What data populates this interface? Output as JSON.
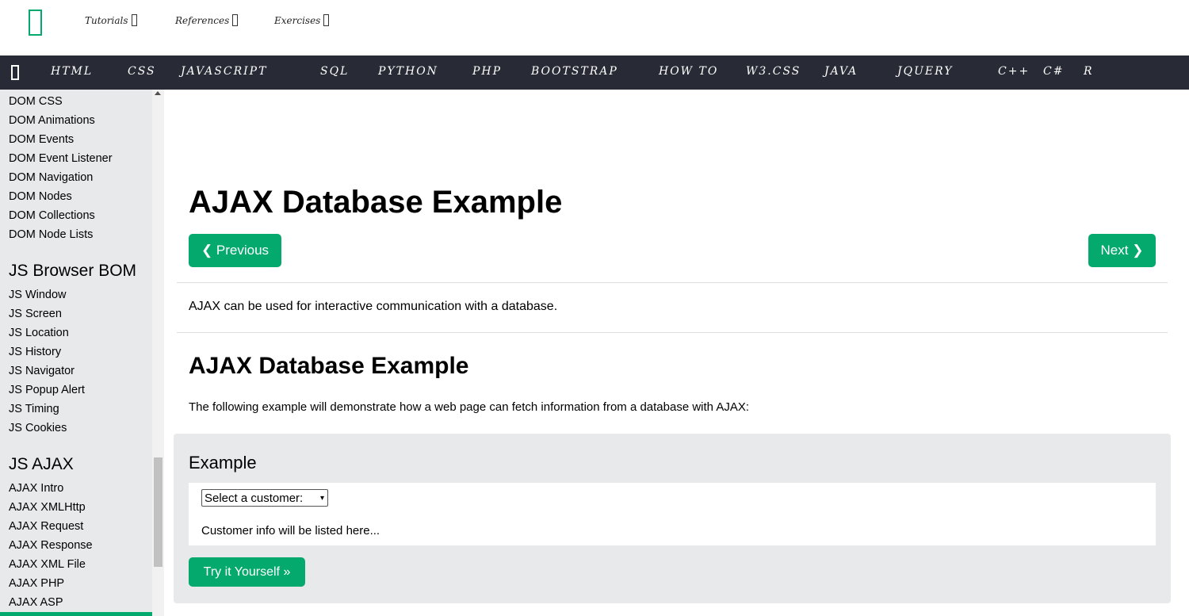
{
  "topbar": {
    "items": [
      {
        "label": "Tutorials"
      },
      {
        "label": "References"
      },
      {
        "label": "Exercises"
      }
    ]
  },
  "darknav": {
    "links": [
      "HTML",
      "CSS",
      "JAVASCRIPT",
      "SQL",
      "PYTHON",
      "PHP",
      "BOOTSTRAP",
      "HOW TO",
      "W3.CSS",
      "JAVA",
      "JQUERY",
      "C++",
      "C#",
      "R"
    ]
  },
  "sidebar": {
    "dom_links": [
      "DOM CSS",
      "DOM Animations",
      "DOM Events",
      "DOM Event Listener",
      "DOM Navigation",
      "DOM Nodes",
      "DOM Collections",
      "DOM Node Lists"
    ],
    "bom_heading": "JS Browser BOM",
    "bom_links": [
      "JS Window",
      "JS Screen",
      "JS Location",
      "JS History",
      "JS Navigator",
      "JS Popup Alert",
      "JS Timing",
      "JS Cookies"
    ],
    "ajax_heading": "JS AJAX",
    "ajax_links": [
      "AJAX Intro",
      "AJAX XMLHttp",
      "AJAX Request",
      "AJAX Response",
      "AJAX XML File",
      "AJAX PHP",
      "AJAX ASP"
    ]
  },
  "main": {
    "title": "AJAX Database Example",
    "prev_label": "❮ Previous",
    "next_label": "Next ❯",
    "intro": "AJAX can be used for interactive communication with a database.",
    "h2": "AJAX Database Example",
    "desc": "The following example will demonstrate how a web page can fetch information from a database with AJAX:",
    "example": {
      "title": "Example",
      "select_value": "Select a customer:",
      "customer_info": "Customer info will be listed here...",
      "try_label": "Try it Yourself »"
    }
  },
  "colors": {
    "accent": "#04AA6D",
    "darknav": "#282A35",
    "sidebar": "#E7E9EB"
  }
}
